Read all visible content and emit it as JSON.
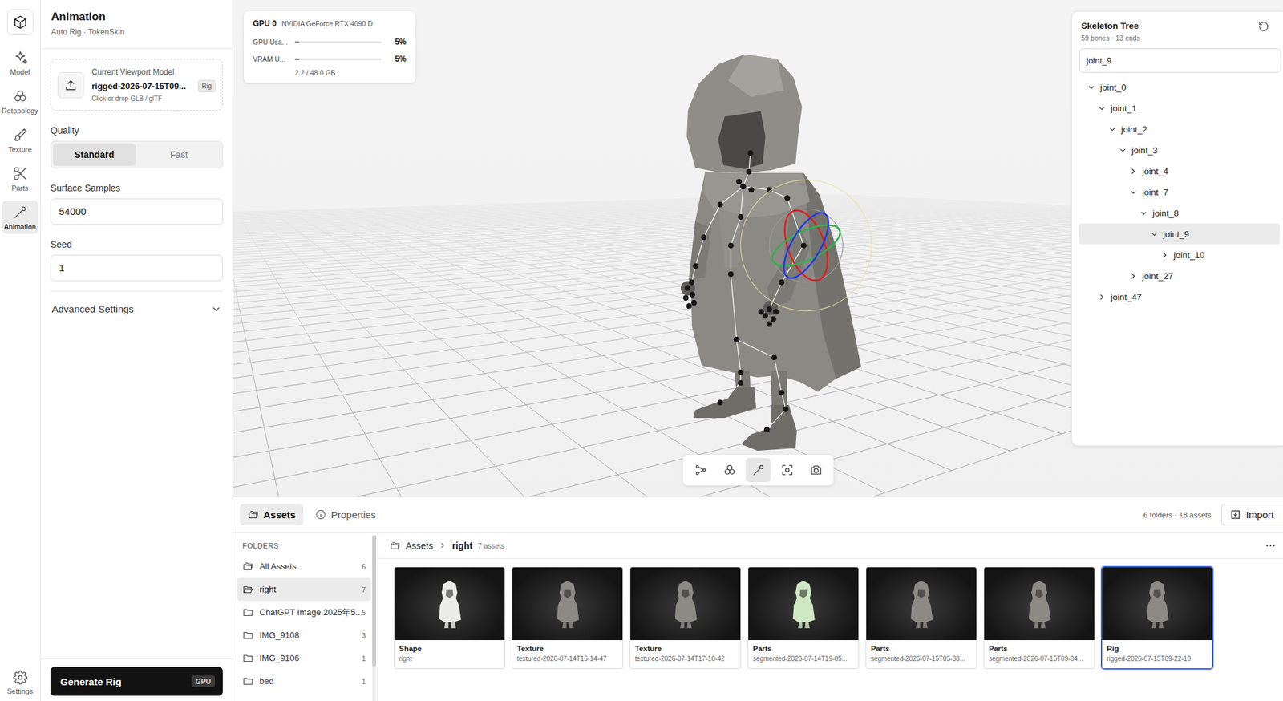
{
  "rail": {
    "items": [
      {
        "label": "Model",
        "selected": false
      },
      {
        "label": "Retopology",
        "selected": false
      },
      {
        "label": "Texture",
        "selected": false
      },
      {
        "label": "Parts",
        "selected": false
      },
      {
        "label": "Animation",
        "selected": true
      }
    ],
    "settings": {
      "label": "Settings",
      "selected": false
    }
  },
  "panel": {
    "title": "Animation",
    "subtitle": "Auto Rig · TokenSkin",
    "upload": {
      "caption": "Current Viewport Model",
      "file": "rigged-2026-07-15T09...",
      "badge": "Rig",
      "hint": "Click or drop GLB / glTF"
    },
    "quality": {
      "label": "Quality",
      "options": [
        {
          "label": "Standard",
          "selected": true
        },
        {
          "label": "Fast",
          "selected": false
        }
      ]
    },
    "fields": [
      {
        "label": "Surface Samples",
        "value": "54000"
      },
      {
        "label": "Seed",
        "value": "1"
      }
    ],
    "advanced": {
      "label": "Advanced Settings",
      "expanded": false
    },
    "generate": {
      "label": "Generate Rig",
      "badge": "GPU"
    }
  },
  "gpu": {
    "title": "GPU 0",
    "device": "NVIDIA GeForce RTX 4090 D",
    "meters": [
      {
        "label": "GPU Usa...",
        "level": 0.05,
        "reading": "5%"
      },
      {
        "label": "VRAM U...",
        "level": 0.05,
        "reading": "5%"
      }
    ],
    "memory": "2.2 / 48.0 GB"
  },
  "skeleton": {
    "title": "Skeleton Tree",
    "summary": "59 bones · 13 ends",
    "search": "joint_9",
    "nodes": [
      {
        "label": "joint_0",
        "depth": 0,
        "expanded": true,
        "selected": false
      },
      {
        "label": "joint_1",
        "depth": 1,
        "expanded": true,
        "selected": false
      },
      {
        "label": "joint_2",
        "depth": 2,
        "expanded": true,
        "selected": false
      },
      {
        "label": "joint_3",
        "depth": 3,
        "expanded": true,
        "selected": false
      },
      {
        "label": "joint_4",
        "depth": 4,
        "expanded": false,
        "selected": false
      },
      {
        "label": "joint_7",
        "depth": 4,
        "expanded": true,
        "selected": false
      },
      {
        "label": "joint_8",
        "depth": 5,
        "expanded": true,
        "selected": false
      },
      {
        "label": "joint_9",
        "depth": 6,
        "expanded": true,
        "selected": true
      },
      {
        "label": "joint_10",
        "depth": 7,
        "expanded": false,
        "selected": false
      },
      {
        "label": "joint_27",
        "depth": 4,
        "expanded": false,
        "selected": false
      },
      {
        "label": "joint_47",
        "depth": 1,
        "expanded": false,
        "selected": false
      }
    ]
  },
  "toolbar": [
    {
      "selected": false
    },
    {
      "selected": false
    },
    {
      "selected": true
    },
    {
      "selected": false
    },
    {
      "selected": false
    }
  ],
  "bottom": {
    "tabs": [
      {
        "label": "Assets",
        "selected": true
      },
      {
        "label": "Properties",
        "selected": false
      }
    ],
    "summary": "6 folders · 18 assets",
    "import": "Import",
    "folders": {
      "heading": "FOLDERS",
      "items": [
        {
          "name": "All Assets",
          "count": "6",
          "selected": false
        },
        {
          "name": "right",
          "count": "7",
          "selected": true
        },
        {
          "name": "ChatGPT Image 2025年5...",
          "count": "5",
          "selected": false
        },
        {
          "name": "IMG_9108",
          "count": "3",
          "selected": false
        },
        {
          "name": "IMG_9106",
          "count": "1",
          "selected": false
        },
        {
          "name": "bed",
          "count": "1",
          "selected": false
        }
      ]
    },
    "breadcrumb": {
      "root": "Assets",
      "current": "right",
      "count": "7 assets"
    },
    "assets": [
      {
        "type": "Shape",
        "name": "right",
        "color": "#ececea",
        "selected": false
      },
      {
        "type": "Texture",
        "name": "textured-2026-07-14T16-14-47",
        "color": "#8c8a84",
        "selected": false
      },
      {
        "type": "Texture",
        "name": "textured-2026-07-14T17-16-42",
        "color": "#8c8a84",
        "selected": false
      },
      {
        "type": "Parts",
        "name": "segmented-2026-07-14T19-05...",
        "color": "#cfe8c4",
        "selected": false
      },
      {
        "type": "Parts",
        "name": "segmented-2026-07-15T05-38...",
        "color": "#8c8a84",
        "selected": false
      },
      {
        "type": "Parts",
        "name": "segmented-2026-07-15T09-04...",
        "color": "#8c8a84",
        "selected": false
      },
      {
        "type": "Rig",
        "name": "rigged-2026-07-15T09-22-10",
        "color": "#8c8a84",
        "selected": true
      }
    ]
  }
}
